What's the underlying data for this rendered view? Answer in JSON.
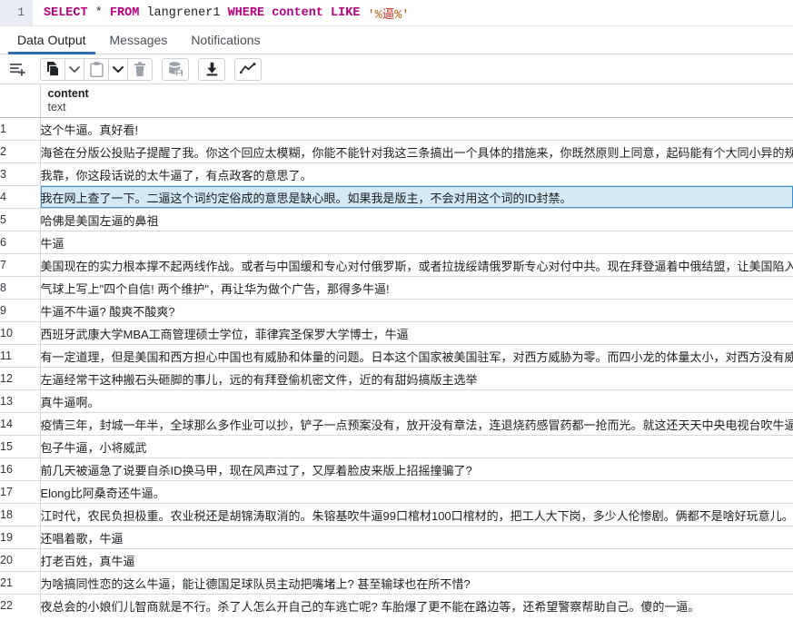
{
  "editor": {
    "line_number": "1",
    "query": "SELECT * FROM langrener1 WHERE content LIKE '%逼%'",
    "tokens": {
      "kw_select": "SELECT",
      "op_star": "*",
      "kw_from": "FROM",
      "table": "langrener1",
      "kw_where": "WHERE",
      "column": "content",
      "kw_like": "LIKE",
      "quote_open": "'%",
      "pattern": "逼",
      "quote_close": "%'"
    }
  },
  "tabs": [
    {
      "label": "Data Output",
      "active": true
    },
    {
      "label": "Messages",
      "active": false
    },
    {
      "label": "Notifications",
      "active": false
    }
  ],
  "toolbar": [
    {
      "name": "add-row-icon",
      "title": "Add row",
      "enabled": true
    },
    {
      "name": "copy-icon",
      "title": "Copy",
      "enabled": true
    },
    {
      "name": "copy-options-chevron-down-icon",
      "title": "Copy options",
      "enabled": true
    },
    {
      "name": "paste-icon",
      "title": "Paste",
      "enabled": false
    },
    {
      "name": "paste-options-chevron-down-icon",
      "title": "Paste options",
      "enabled": true
    },
    {
      "name": "delete-trash-icon",
      "title": "Delete row",
      "enabled": false
    },
    {
      "name": "save-data-changes-icon",
      "title": "Save data changes",
      "enabled": false
    },
    {
      "name": "download-icon",
      "title": "Download as CSV",
      "enabled": true
    },
    {
      "name": "graph-visualiser-icon",
      "title": "Graph Visualiser",
      "enabled": true
    }
  ],
  "grid": {
    "column": {
      "name": "content",
      "type": "text"
    },
    "selected_row": 4,
    "rows": [
      {
        "n": "1",
        "content": "这个牛逼。真好看!"
      },
      {
        "n": "2",
        "content": "海爸在分版公投贴子提醒了我。你这个回应太模糊，你能不能针对我这三条搞出一个具体的措施来，你既然原则上同意，起码能有个大同小异的规则吧。不"
      },
      {
        "n": "3",
        "content": "我靠，你这段话说的太牛逼了，有点政客的意思了。"
      },
      {
        "n": "4",
        "content": "我在网上查了一下。二逼这个词约定俗成的意思是缺心眼。如果我是版主，不会对用这个词的ID封禁。"
      },
      {
        "n": "5",
        "content": "哈佛是美国左逼的鼻祖"
      },
      {
        "n": "6",
        "content": "牛逼"
      },
      {
        "n": "7",
        "content": "美国现在的实力根本撑不起两线作战。或者与中国缓和专心对付俄罗斯，或者拉拢绥靖俄罗斯专心对付中共。现在拜登逼着中俄结盟，让美国陷入两线作战"
      },
      {
        "n": "8",
        "content": "气球上写上\"四个自信! 两个维护\"，再让华为做个广告，那得多牛逼!"
      },
      {
        "n": "9",
        "content": "牛逼不牛逼? 酸爽不酸爽?"
      },
      {
        "n": "10",
        "content": "西班牙武康大学MBA工商管理硕士学位，菲律宾圣保罗大学博士，牛逼"
      },
      {
        "n": "11",
        "content": "有一定道理，但是美国和西方担心中国也有威胁和体量的问题。日本这个国家被美国驻军，对西方威胁为零。而四小龙的体量太小，对西方没有威胁。中国"
      },
      {
        "n": "12",
        "content": "左逼经常干这种搬石头砸脚的事儿，远的有拜登偷机密文件，近的有甜妈搞版主选举"
      },
      {
        "n": "13",
        "content": "真牛逼啊。"
      },
      {
        "n": "14",
        "content": "疫情三年，封城一年半，全球那么多作业可以抄，铲子一点预案没有，放开没有章法，连退烧药感冒药都一抢而光。就这还天天中央电视台吹牛逼偷着乐去"
      },
      {
        "n": "15",
        "content": "包子牛逼，小将威武"
      },
      {
        "n": "16",
        "content": "前几天被逼急了说要自杀ID换马甲，现在风声过了，又厚着脸皮来版上招摇撞骗了?"
      },
      {
        "n": "17",
        "content": "Elong比阿桑奇还牛逼。"
      },
      {
        "n": "18",
        "content": "江时代，农民负担极重。农业税还是胡锦涛取消的。朱镕基吹牛逼99口棺材100口棺材的，把工人大下岗，多少人伦惨剧。俩都不是啥好玩意儿。怀念个屁"
      },
      {
        "n": "19",
        "content": "还唱着歌，牛逼"
      },
      {
        "n": "20",
        "content": "打老百姓，真牛逼"
      },
      {
        "n": "21",
        "content": "为啥搞同性恋的这么牛逼，能让德国足球队员主动把嘴堵上? 甚至输球也在所不惜?"
      },
      {
        "n": "22",
        "content": "夜总会的小娘们儿智商就是不行。杀了人怎么开自己的车逃亡呢? 车胎爆了更不能在路边等，还希望警察帮助自己。傻的一逼。"
      }
    ]
  },
  "colors": {
    "accent": "#2c6fb5",
    "selection_bg": "#d2e9f7",
    "selection_border": "#3f8fcb",
    "keyword": "#b5007f",
    "string": "#b35b00",
    "gutter_bg": "#e9ecf2"
  }
}
